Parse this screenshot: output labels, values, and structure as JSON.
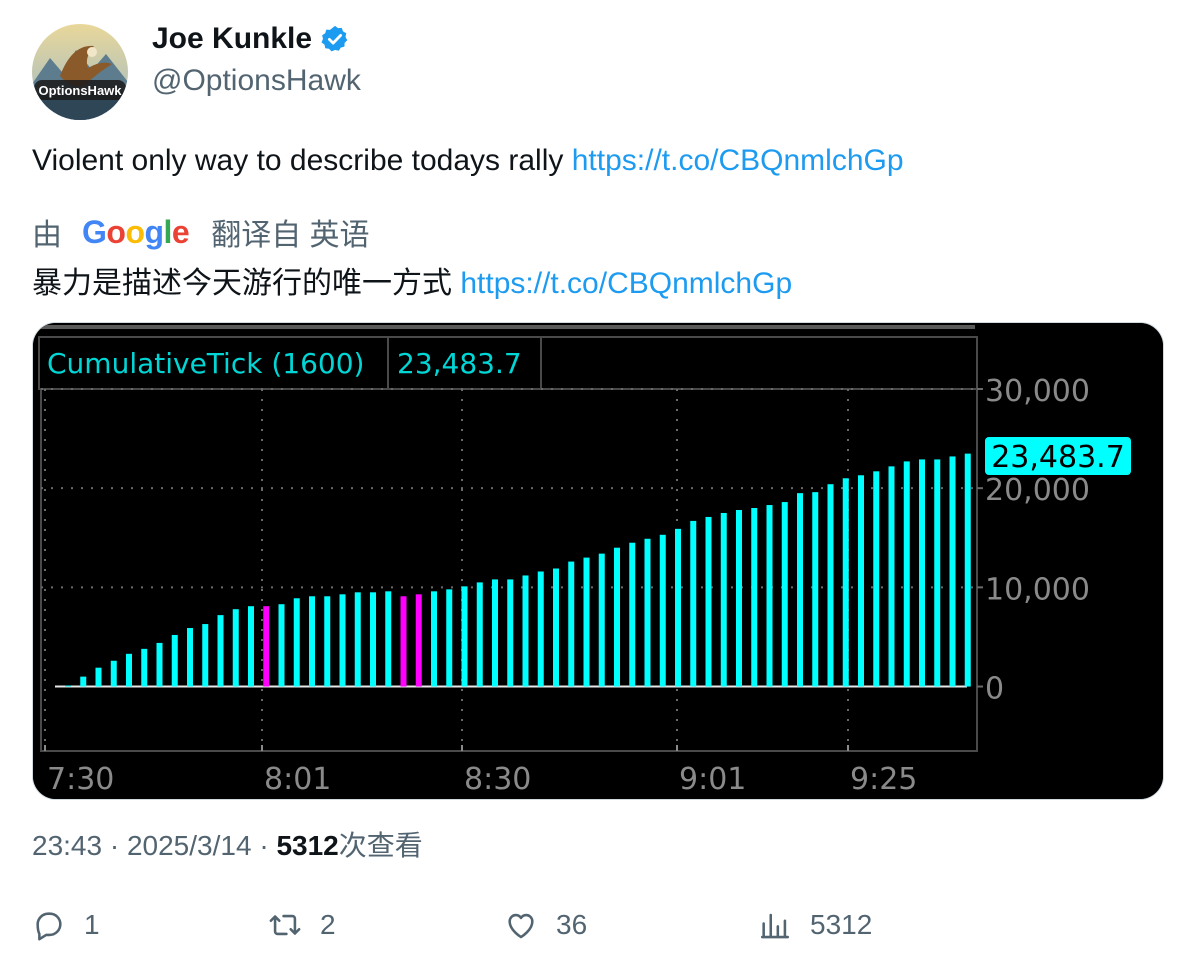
{
  "author": {
    "name": "Joe Kunkle",
    "handle": "@OptionsHawk",
    "avatar_text": "OptionsHawk",
    "verified": true
  },
  "tweet": {
    "text": "Violent only way to describe todays rally ",
    "link": "https://t.co/CBQnmlchGp"
  },
  "translation": {
    "prefix": "由",
    "provider": "Google",
    "suffix": "翻译自 英语",
    "text": "暴力是描述今天游行的唯一方式 ",
    "link": "https://t.co/CBQnmlchGp"
  },
  "meta": {
    "time": "23:43",
    "date": "2025/3/14",
    "views_count": "5312",
    "views_label": "次查看"
  },
  "actions": {
    "reply": "1",
    "retweet": "2",
    "like": "36",
    "views": "5312"
  },
  "colors": {
    "link": "#1d9bf0",
    "bar_up": "#00ffff",
    "bar_down": "#ff00ff",
    "chart_bg": "#000000"
  },
  "chart_data": {
    "type": "bar",
    "title": "CumulativeTick (1600)",
    "title_value": "23,483.7",
    "last_value_label": "23,483.7",
    "ylim": [
      -6500,
      30000
    ],
    "y_ticks": [
      30000,
      20000,
      10000,
      0
    ],
    "y_tick_labels": [
      "30,000",
      "20,000",
      "10,000",
      "0"
    ],
    "x_tick_labels": [
      "7:30",
      "8:01",
      "8:30",
      "9:01",
      "9:25"
    ],
    "grid": true,
    "values": [
      100,
      1000,
      1900,
      2600,
      3300,
      3800,
      4400,
      5200,
      5900,
      6300,
      7200,
      7800,
      8100,
      8100,
      8300,
      8900,
      9100,
      9100,
      9300,
      9500,
      9500,
      9600,
      9100,
      9300,
      9600,
      9800,
      10100,
      10500,
      10800,
      10800,
      11200,
      11600,
      11900,
      12600,
      13000,
      13400,
      14000,
      14500,
      14900,
      15300,
      15900,
      16700,
      17100,
      17500,
      17800,
      18000,
      18300,
      18600,
      19500,
      19600,
      20400,
      21000,
      21300,
      21700,
      22200,
      22700,
      22900,
      22900,
      23200,
      23483.7
    ],
    "down_indices": [
      13,
      22,
      23
    ]
  }
}
